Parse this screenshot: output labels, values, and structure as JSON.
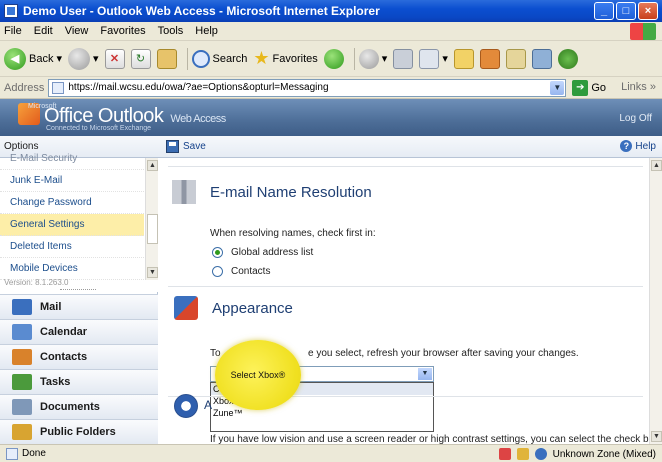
{
  "window": {
    "title": "Demo User - Outlook Web Access - Microsoft Internet Explorer"
  },
  "menubar": {
    "items": [
      "File",
      "Edit",
      "View",
      "Favorites",
      "Tools",
      "Help"
    ]
  },
  "toolbar": {
    "back_label": "Back",
    "search_label": "Search",
    "favorites_label": "Favorites"
  },
  "addressbar": {
    "label": "Address",
    "url": "https://mail.wcsu.edu/owa/?ae=Options&opturl=Messaging",
    "go_label": "Go",
    "links_label": "Links"
  },
  "owa": {
    "brand_small": "Microsoft",
    "title": "Office Outlook",
    "title_suffix": "Web Access",
    "subtitle": "Connected to Microsoft Exchange",
    "logoff_label": "Log Off"
  },
  "command_bar": {
    "options_label": "Options",
    "save_label": "Save",
    "help_label": "Help"
  },
  "options_list": {
    "items": [
      {
        "label": "E-Mail Security",
        "selected": false
      },
      {
        "label": "Junk E-Mail",
        "selected": false
      },
      {
        "label": "Change Password",
        "selected": false
      },
      {
        "label": "General Settings",
        "selected": true
      },
      {
        "label": "Deleted Items",
        "selected": false
      },
      {
        "label": "Mobile Devices",
        "selected": false
      }
    ],
    "version": "Version: 8.1.263.0"
  },
  "navigation": {
    "items": [
      {
        "label": "Mail",
        "icon": "mail-icon",
        "color": "#3a6fbe"
      },
      {
        "label": "Calendar",
        "icon": "calendar-icon",
        "color": "#5a8bd0"
      },
      {
        "label": "Contacts",
        "icon": "contacts-icon",
        "color": "#d9822b"
      },
      {
        "label": "Tasks",
        "icon": "tasks-icon",
        "color": "#4b9a3c"
      },
      {
        "label": "Documents",
        "icon": "documents-icon",
        "color": "#7f98b8"
      },
      {
        "label": "Public Folders",
        "icon": "public-folders-icon",
        "color": "#d8a431"
      }
    ]
  },
  "email_resolution": {
    "title": "E-mail Name Resolution",
    "prompt": "When resolving names, check first in:",
    "options": [
      "Global address list",
      "Contacts"
    ],
    "selected_index": 0
  },
  "appearance": {
    "title": "Appearance",
    "text_start": "To",
    "text_end": "e you select, refresh your browser after saving your changes.",
    "theme_options": [
      "Co",
      "Xbox®",
      "Zune™"
    ],
    "theme_highlight_index": 0
  },
  "accessibility": {
    "title_start": "A",
    "text": "If you have low vision and use a screen reader or high contrast settings, you can select the check box"
  },
  "highlight": {
    "label": "Select Xbox®"
  },
  "statusbar": {
    "done_label": "Done",
    "zone_label": "Unknown Zone (Mixed)"
  },
  "colors": {
    "title_blue": "#0a47c4",
    "owa_header": "#4d6e98",
    "selected_item": "#fdeea8",
    "highlight_yellow": "#f0e020"
  }
}
